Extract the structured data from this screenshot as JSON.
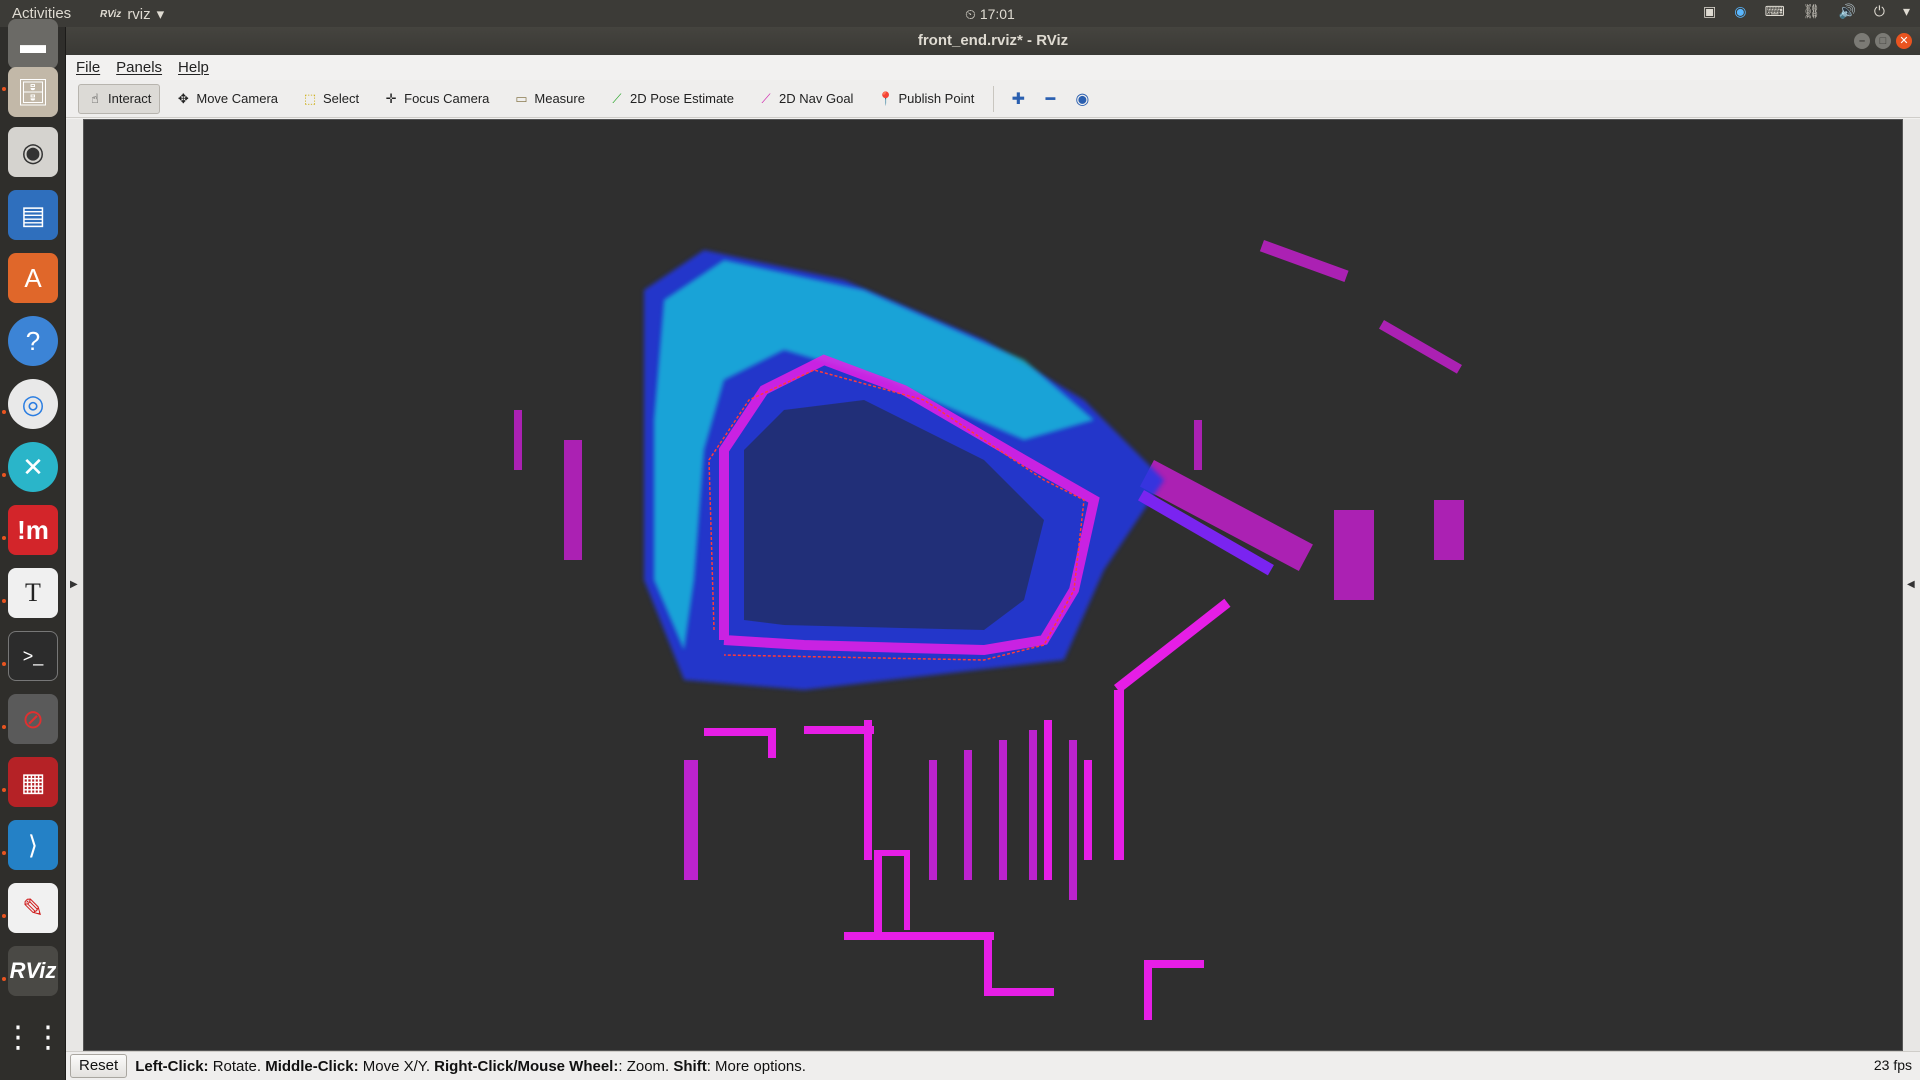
{
  "top_panel": {
    "activities": "Activities",
    "app_name": "rviz",
    "app_badge": "RViz",
    "clock": "17:01"
  },
  "window": {
    "title": "front_end.rviz* - RViz"
  },
  "menubar": {
    "items": [
      "File",
      "Panels",
      "Help"
    ]
  },
  "toolbar": {
    "tools": [
      {
        "label": "Interact",
        "icon": "hand-icon",
        "active": true
      },
      {
        "label": "Move Camera",
        "icon": "move-icon",
        "active": false
      },
      {
        "label": "Select",
        "icon": "select-icon",
        "active": false
      },
      {
        "label": "Focus Camera",
        "icon": "focus-icon",
        "active": false
      },
      {
        "label": "Measure",
        "icon": "ruler-icon",
        "active": false
      },
      {
        "label": "2D Pose Estimate",
        "icon": "green-arrow-icon",
        "active": false
      },
      {
        "label": "2D Nav Goal",
        "icon": "pink-arrow-icon",
        "active": false
      },
      {
        "label": "Publish Point",
        "icon": "pin-icon",
        "active": false
      }
    ]
  },
  "statusbar": {
    "reset": "Reset",
    "hint_left_click": "Left-Click:",
    "hint_rotate": " Rotate. ",
    "hint_middle_click": "Middle-Click:",
    "hint_move": " Move X/Y. ",
    "hint_right_click": "Right-Click/Mouse Wheel:",
    "hint_zoom": ": Zoom. ",
    "hint_shift": "Shift",
    "hint_more": ": More options.",
    "fps": "23 fps"
  },
  "colors": {
    "accent": "#e95420",
    "point_magenta": "#e61ee6",
    "point_blue": "#1e50ff",
    "point_cyan": "#19c8dc",
    "point_purple": "#7a24f0"
  }
}
